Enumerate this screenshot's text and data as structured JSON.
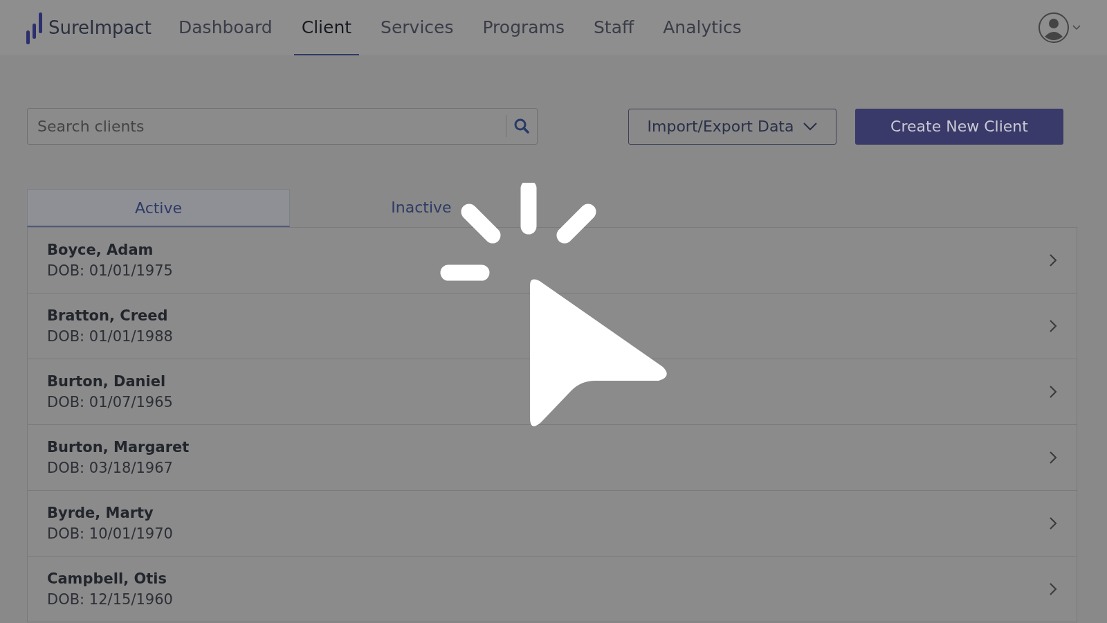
{
  "header": {
    "logo": "SureImpact",
    "nav": [
      {
        "label": "Dashboard",
        "selected": false
      },
      {
        "label": "Client",
        "selected": true
      },
      {
        "label": "Services",
        "selected": false
      },
      {
        "label": "Programs",
        "selected": false
      },
      {
        "label": "Staff",
        "selected": false
      },
      {
        "label": "Analytics",
        "selected": false
      }
    ]
  },
  "toolbar": {
    "search": {
      "placeholder": "Search clients"
    },
    "import_export": "Import/Export Data",
    "create": "Create New Client"
  },
  "tabs": [
    {
      "label": "Active",
      "selected": true
    },
    {
      "label": "Inactive",
      "selected": false
    }
  ],
  "clients": [
    {
      "name": "Boyce, Adam",
      "dob": "DOB: 01/01/1975"
    },
    {
      "name": "Bratton, Creed",
      "dob": "DOB: 01/01/1988"
    },
    {
      "name": "Burton, Daniel",
      "dob": "DOB: 01/07/1965"
    },
    {
      "name": "Burton, Margaret",
      "dob": "DOB: 03/18/1967"
    },
    {
      "name": "Byrde, Marty",
      "dob": "DOB: 10/01/1970"
    },
    {
      "name": "Campbell, Otis",
      "dob": "DOB: 12/15/1960"
    }
  ]
}
